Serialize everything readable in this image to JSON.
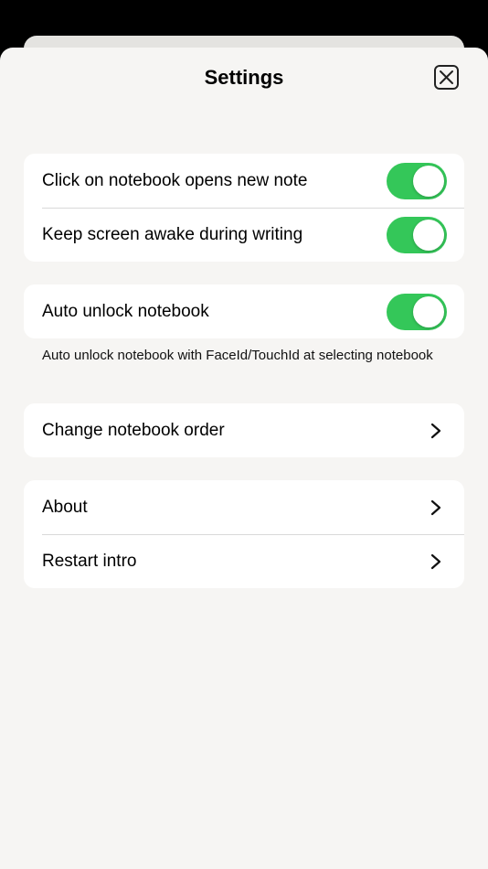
{
  "header": {
    "title": "Settings",
    "close_icon": "close-x-icon"
  },
  "groups": {
    "general": {
      "open_new_note": {
        "label": "Click on notebook opens new note",
        "on": true
      },
      "keep_awake": {
        "label": "Keep screen awake during writing",
        "on": true
      }
    },
    "security": {
      "auto_unlock": {
        "label": "Auto unlock notebook",
        "on": true
      },
      "footnote": "Auto unlock notebook with FaceId/TouchId at selecting notebook"
    },
    "order": {
      "change_order": {
        "label": "Change notebook order",
        "icon": "chevron-right-icon"
      }
    },
    "info": {
      "about": {
        "label": "About",
        "icon": "chevron-right-icon"
      },
      "restart_intro": {
        "label": "Restart intro",
        "icon": "chevron-right-icon"
      }
    }
  },
  "colors": {
    "toggle_on": "#34c759",
    "sheet_bg": "#f6f5f3",
    "card_bg": "#ffffff"
  }
}
